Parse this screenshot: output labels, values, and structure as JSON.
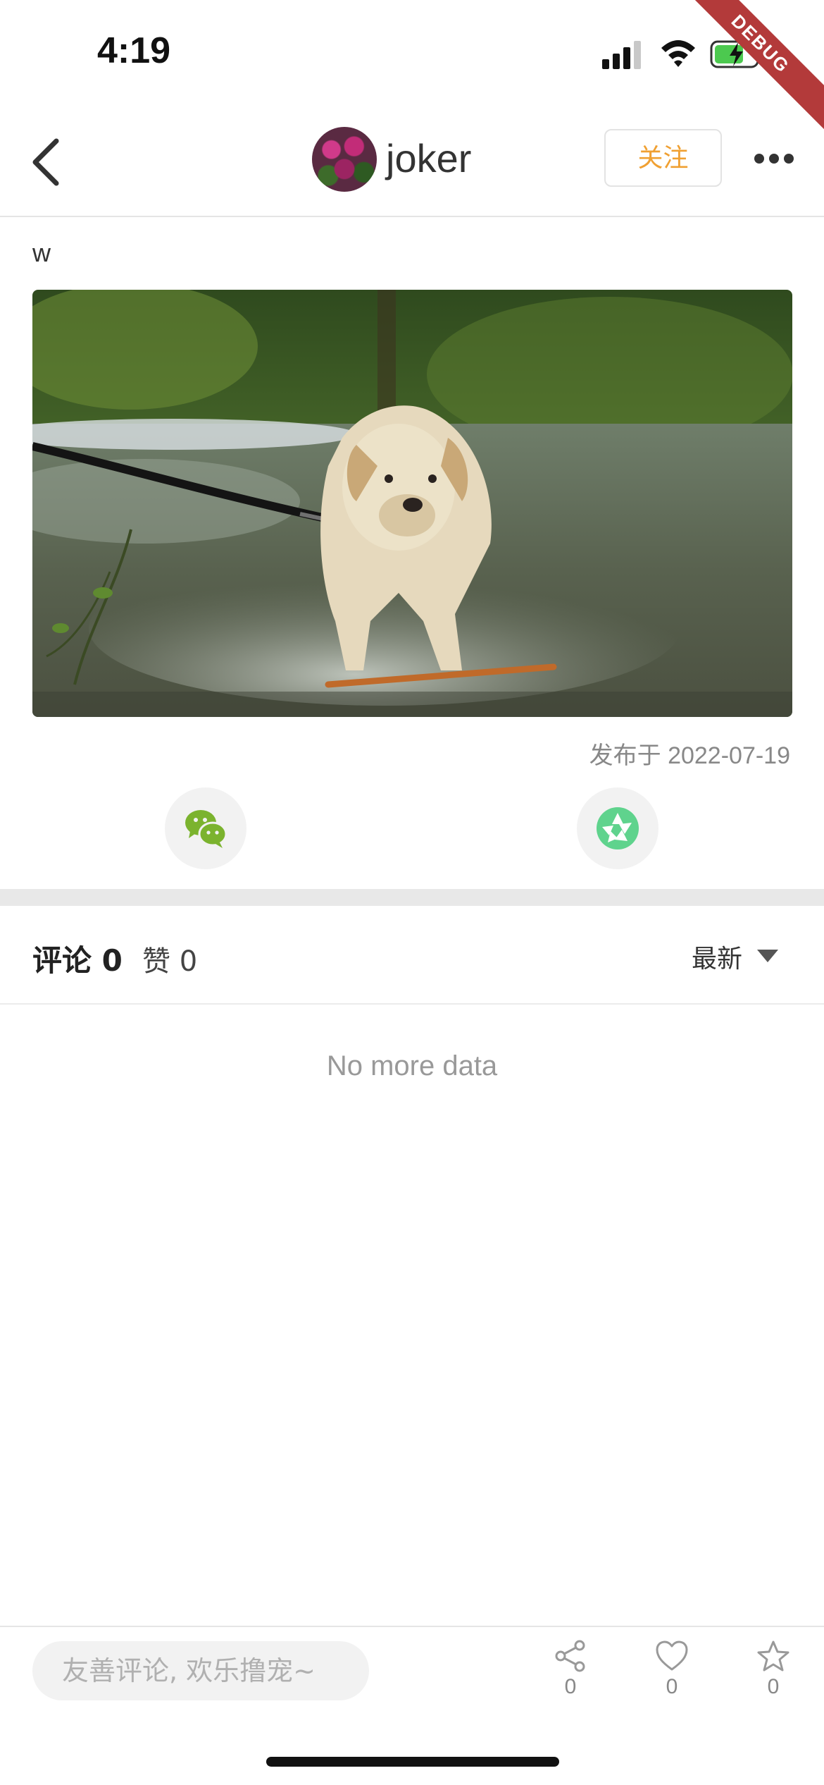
{
  "status_bar": {
    "time": "4:19",
    "icons": [
      "signal-icon",
      "wifi-icon",
      "battery-charging-icon"
    ],
    "debug_label": "DEBUG"
  },
  "navbar": {
    "back_icon": "back-chevron-icon",
    "username": "joker",
    "follow_label": "关注",
    "more_icon": "more-dots-icon"
  },
  "post": {
    "text": "w",
    "image_alt": "labrador-in-river",
    "date": "发布于 2022-07-19"
  },
  "share": {
    "wechat_icon": "wechat-icon",
    "moments_icon": "moments-icon"
  },
  "comments": {
    "tab_label": "评论 0",
    "likes_label": "赞 0",
    "sort_label": "最新",
    "empty_text": "No more data"
  },
  "bottom_bar": {
    "input_placeholder": "友善评论, 欢乐撸宠~",
    "share_count": "0",
    "like_count": "0",
    "favorite_count": "0"
  },
  "colors": {
    "accent": "#f0a032",
    "wechat_green": "#7bb32e",
    "moments_green": "#5fd38d",
    "debug_red": "#b33a3a"
  }
}
